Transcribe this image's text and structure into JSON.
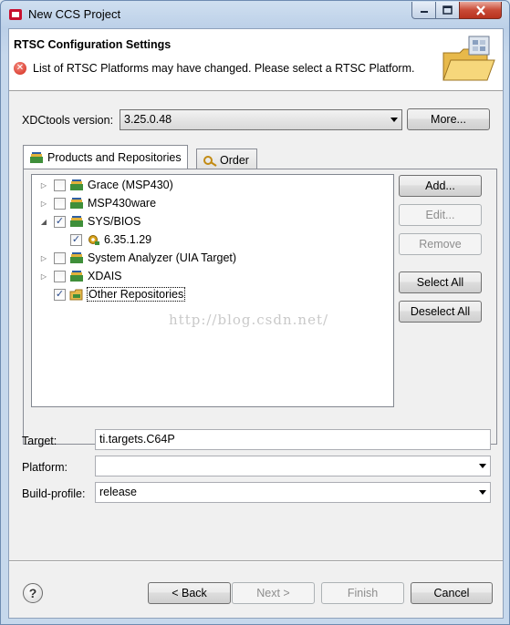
{
  "window": {
    "title": "New CCS Project"
  },
  "banner": {
    "title": "RTSC Configuration Settings",
    "message": "List of RTSC Platforms may have changed. Please select a RTSC Platform."
  },
  "xdc": {
    "label": "XDCtools version:",
    "value": "3.25.0.48",
    "more_label": "More..."
  },
  "tabs": [
    {
      "label": "Products and Repositories",
      "active": true
    },
    {
      "label": "Order",
      "active": false
    }
  ],
  "tree": {
    "items": [
      {
        "label": "Grace (MSP430)",
        "checked": false,
        "expander": "▷"
      },
      {
        "label": "MSP430ware",
        "checked": false,
        "expander": "▷"
      },
      {
        "label": "SYS/BIOS",
        "checked": true,
        "expander": "◢"
      },
      {
        "label": "6.35.1.29",
        "checked": true,
        "expander": ""
      },
      {
        "label": "System Analyzer (UIA Target)",
        "checked": false,
        "expander": "▷"
      },
      {
        "label": "XDAIS",
        "checked": false,
        "expander": "▷"
      },
      {
        "label": "Other Repositories",
        "checked": true,
        "expander": ""
      }
    ]
  },
  "side_buttons": {
    "add": "Add...",
    "edit": "Edit...",
    "remove": "Remove",
    "select_all": "Select All",
    "deselect_all": "Deselect All"
  },
  "watermark": "http://blog.csdn.net/",
  "form": {
    "target_label": "Target:",
    "target_value": "ti.targets.C64P",
    "platform_label": "Platform:",
    "platform_value": "",
    "profile_label": "Build-profile:",
    "profile_value": "release"
  },
  "footer": {
    "help": "?",
    "back": "< Back",
    "next": "Next >",
    "finish": "Finish",
    "cancel": "Cancel"
  },
  "colors": {
    "check": "#2a4b8d",
    "error": "#d3281b",
    "close_button": "#c94a36"
  }
}
